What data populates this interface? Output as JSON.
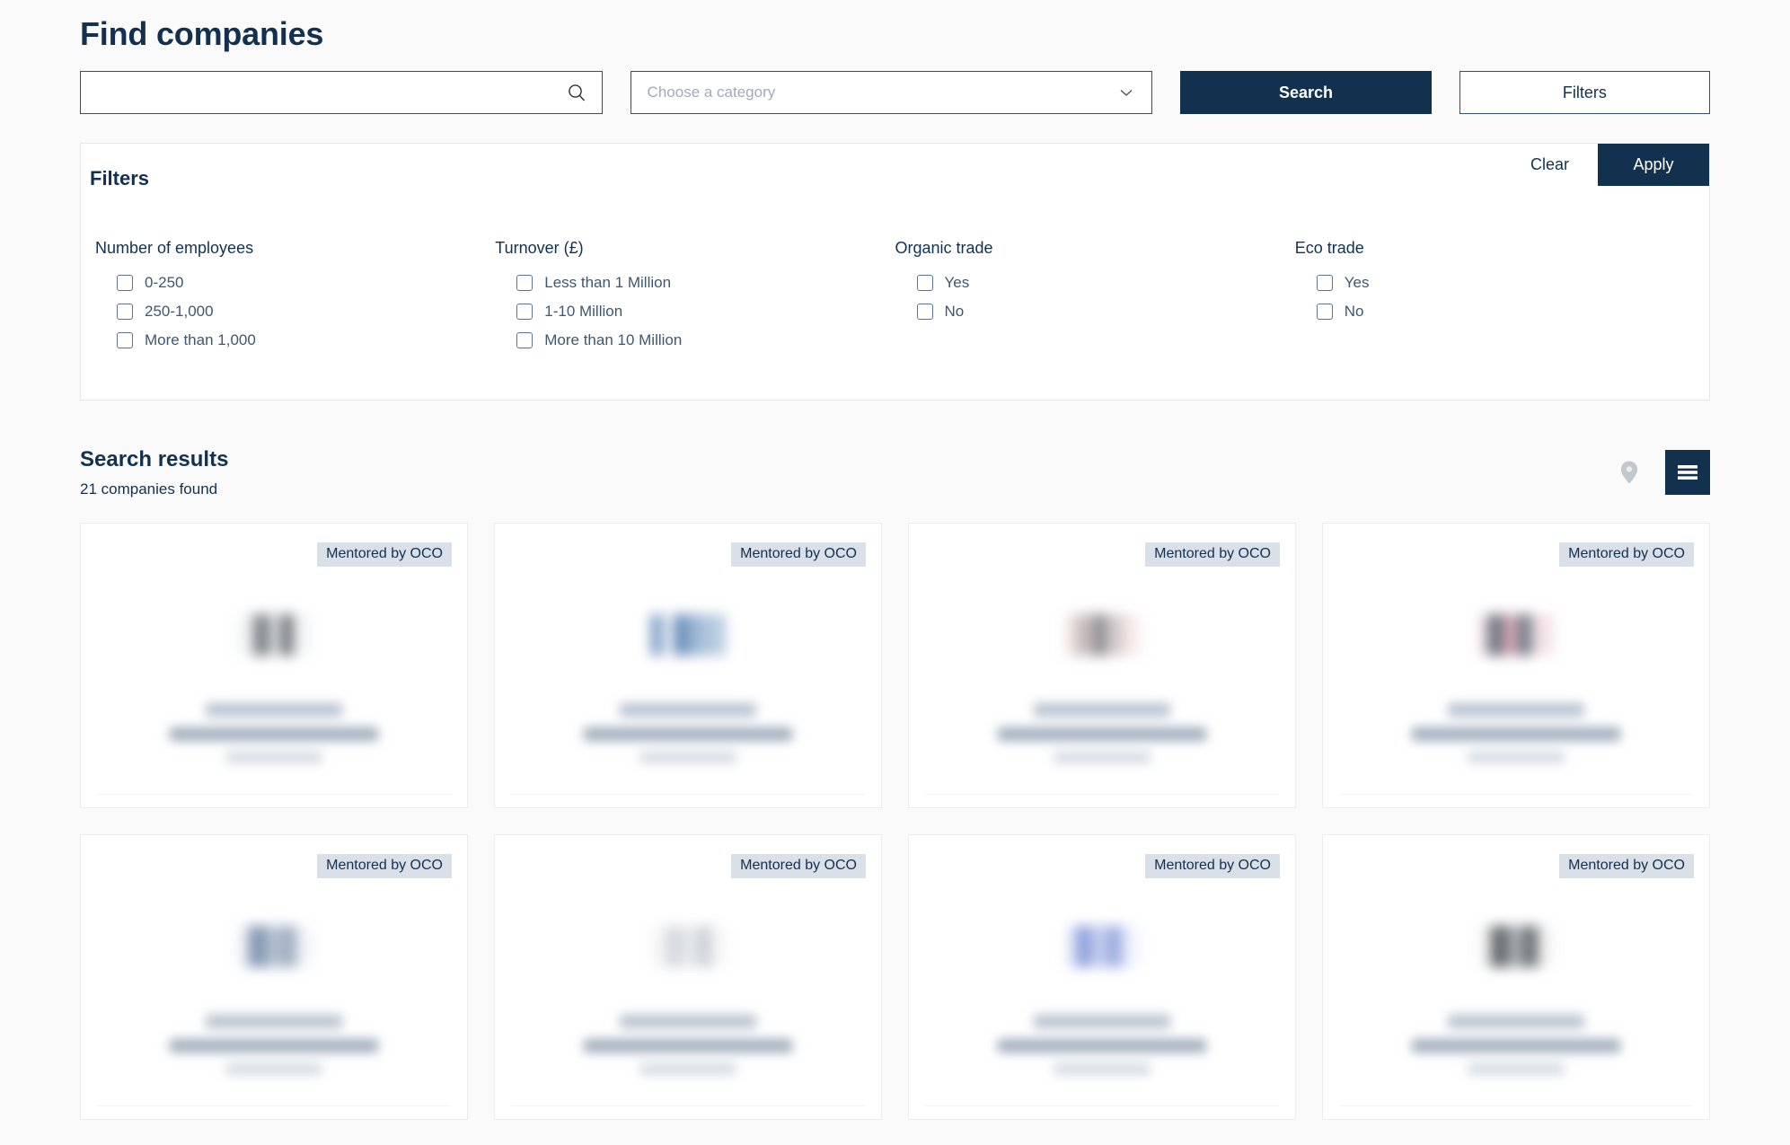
{
  "page": {
    "title": "Find companies"
  },
  "search": {
    "input_value": "",
    "input_placeholder": "",
    "search_icon": "search-icon",
    "category_placeholder": "Choose a category",
    "category_chevron_icon": "chevron-down-icon",
    "search_button_label": "Search",
    "filters_button_label": "Filters"
  },
  "filters_panel": {
    "title": "Filters",
    "clear_label": "Clear",
    "apply_label": "Apply",
    "groups": [
      {
        "title": "Number of employees",
        "options": [
          {
            "label": "0-250",
            "checked": false
          },
          {
            "label": "250-1,000",
            "checked": false
          },
          {
            "label": "More than 1,000",
            "checked": false
          }
        ]
      },
      {
        "title": "Turnover (£)",
        "options": [
          {
            "label": "Less than 1 Million",
            "checked": false
          },
          {
            "label": "1-10 Million",
            "checked": false
          },
          {
            "label": "More than 10 Million",
            "checked": false
          }
        ]
      },
      {
        "title": "Organic trade",
        "options": [
          {
            "label": "Yes",
            "checked": false
          },
          {
            "label": "No",
            "checked": false
          }
        ]
      },
      {
        "title": "Eco trade",
        "options": [
          {
            "label": "Yes",
            "checked": false
          },
          {
            "label": "No",
            "checked": false
          }
        ]
      }
    ]
  },
  "results": {
    "title": "Search results",
    "count_text": "21 companies found",
    "view_map_icon": "map-pin-icon",
    "view_list_icon": "list-view-icon",
    "active_view": "list",
    "cards": [
      {
        "badge": "Mentored by OCO",
        "logo_tone": "gray"
      },
      {
        "badge": "Mentored by OCO",
        "logo_tone": "blue"
      },
      {
        "badge": "Mentored by OCO",
        "logo_tone": "pink"
      },
      {
        "badge": "Mentored by OCO",
        "logo_tone": "rose"
      },
      {
        "badge": "Mentored by OCO",
        "logo_tone": "slateblue"
      },
      {
        "badge": "Mentored by OCO",
        "logo_tone": "softgray"
      },
      {
        "badge": "Mentored by OCO",
        "logo_tone": "periwinkle"
      },
      {
        "badge": "Mentored by OCO",
        "logo_tone": "charcoal"
      }
    ]
  },
  "colors": {
    "brand_navy": "#12314f",
    "page_background": "#fafafa",
    "badge_background": "#d9e0e8",
    "card_background": "#ffffff"
  }
}
